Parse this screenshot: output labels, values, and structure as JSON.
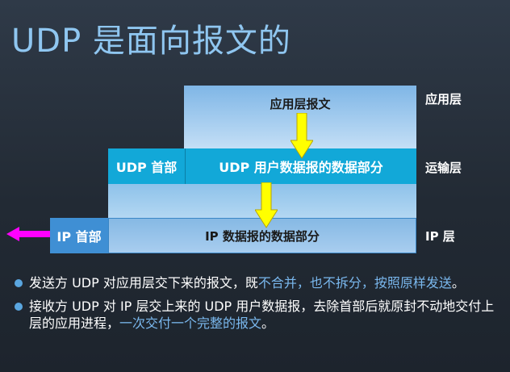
{
  "title": "UDP 是面向报文的",
  "diagram": {
    "app_message": "应用层报文",
    "udp_header": "UDP 首部",
    "udp_data": "UDP 用户数据报的数据部分",
    "ip_header": "IP 首部",
    "ip_data": "IP 数据报的数据部分",
    "layers": {
      "application": "应用层",
      "transport": "运输层",
      "ip": "IP 层"
    },
    "colors": {
      "down_arrow": "#ffff00",
      "left_arrow": "#ff00ff",
      "highlight_text": "#7ab8ee"
    }
  },
  "bullets": [
    {
      "text_before": "发送方 UDP 对应用层交下来的报文，既",
      "highlight": "不合并，也不拆分，按照原样发送",
      "text_after": "。"
    },
    {
      "text_before": "接收方 UDP 对 IP 层交上来的 UDP 用户数据报，去除首部后就原封不动地交付上层的应用进程，",
      "highlight": "一次交付一个完整的报文",
      "text_after": "。"
    }
  ]
}
